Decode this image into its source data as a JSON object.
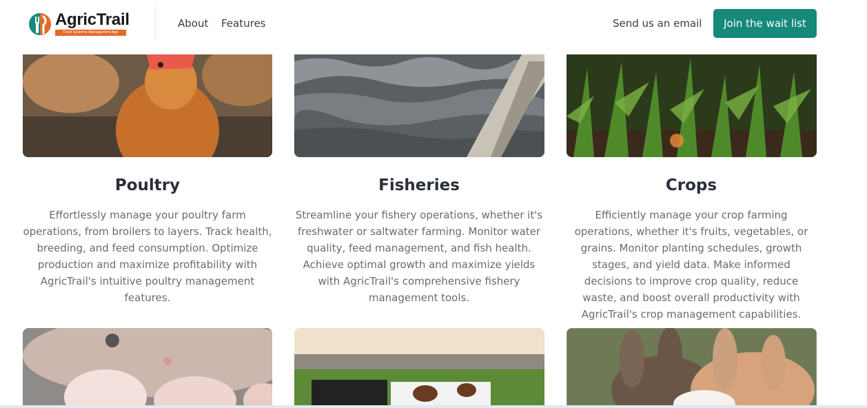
{
  "header": {
    "logo_name": "AgricTrail",
    "logo_tagline": "Food Systems Management App",
    "nav": {
      "about": "About",
      "features": "Features",
      "email": "Send us an email"
    },
    "cta_label": "Join the wait list",
    "colors": {
      "accent": "#15897a",
      "logo_orange": "#e36b2a"
    }
  },
  "cards": [
    {
      "title": "Poultry",
      "description": "Effortlessly manage your poultry farm operations, from broilers to layers. Track health, breeding, and feed consumption. Optimize production and maximize profitability with AgricTrail's intuitive poultry management features."
    },
    {
      "title": "Fisheries",
      "description": "Streamline your fishery operations, whether it's freshwater or saltwater farming. Monitor water quality, feed management, and fish health. Achieve optimal growth and maximize yields with AgricTrail's comprehensive fishery management tools."
    },
    {
      "title": "Crops",
      "description": "Efficiently manage your crop farming operations, whether it's fruits, vegetables, or grains. Monitor planting schedules, growth stages, and yield data. Make informed decisions to improve crop quality, reduce waste, and boost overall productivity with AgricTrail's crop management capabilities."
    }
  ]
}
